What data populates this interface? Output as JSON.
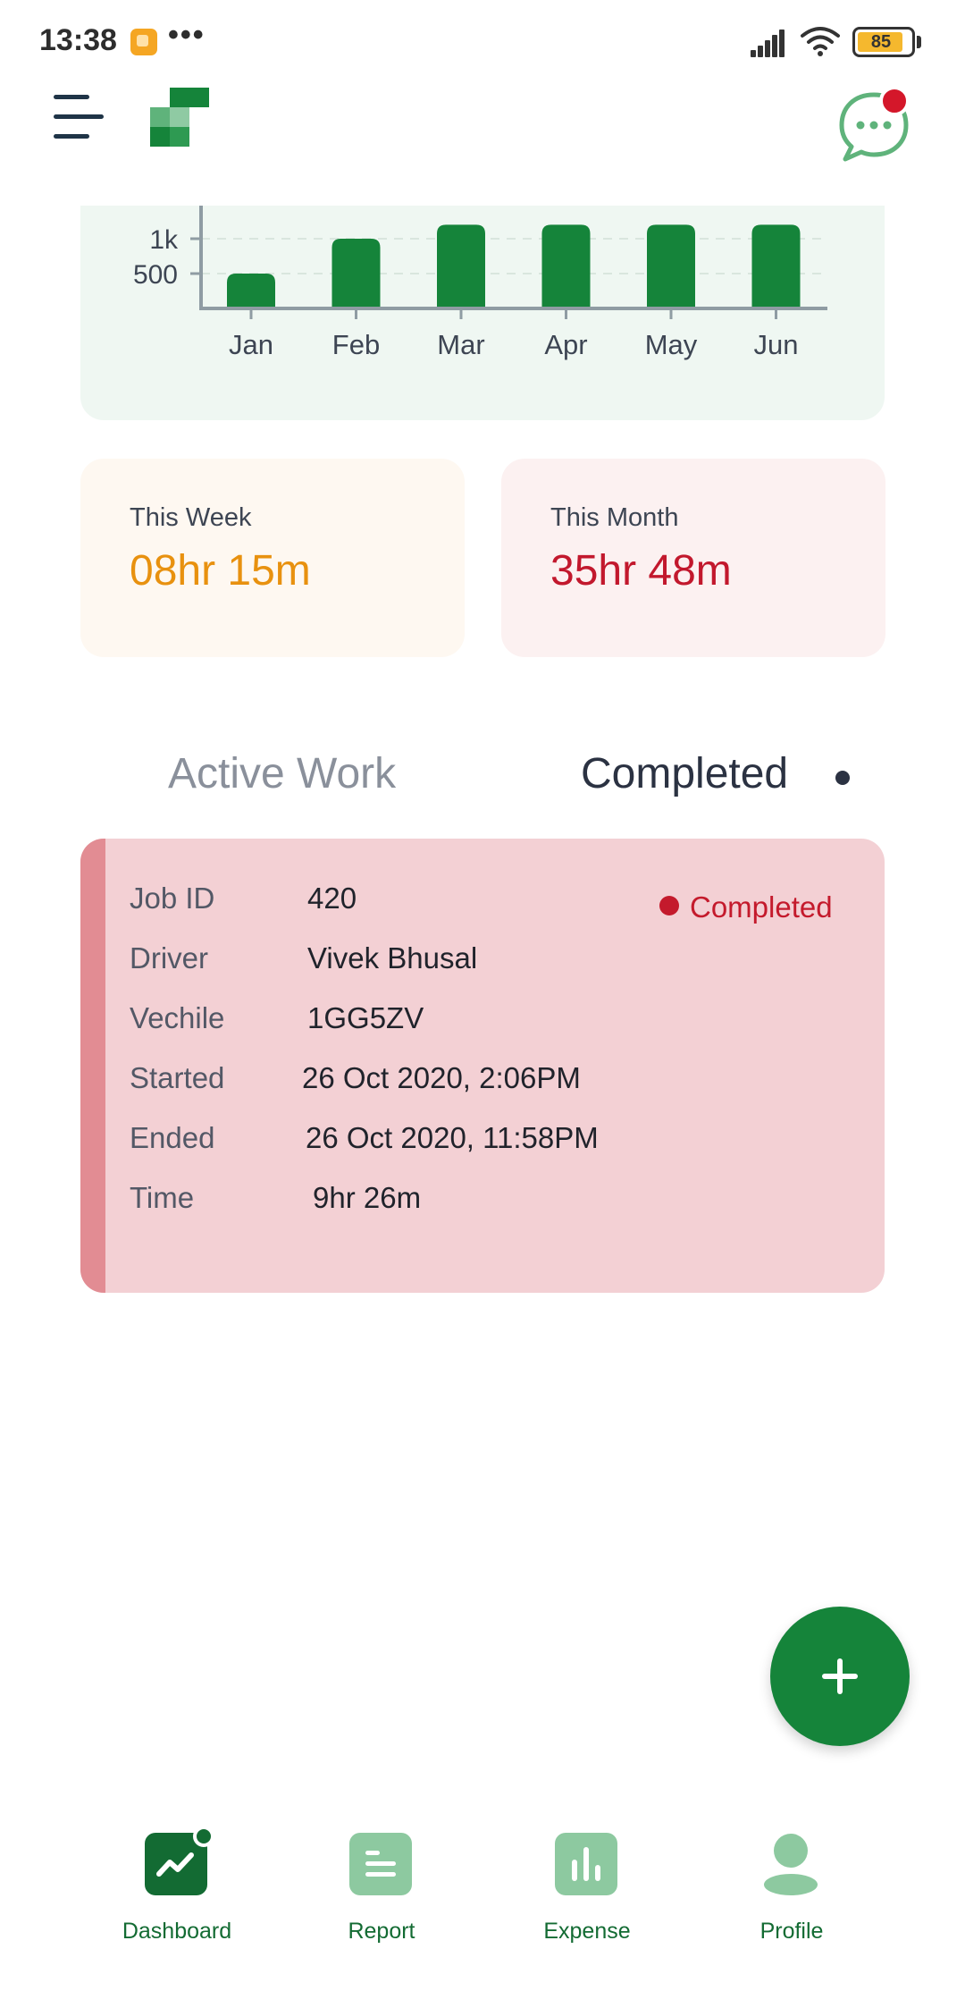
{
  "status_bar": {
    "time": "13:38",
    "dots": "•••",
    "battery_level": "85"
  },
  "header": {
    "menu_icon": "hamburger-menu-icon",
    "logo_icon": "app-logo",
    "chat_icon": "chat-bubble-icon",
    "chat_has_notification": true
  },
  "chart_data": {
    "type": "bar",
    "categories": [
      "Jan",
      "Feb",
      "Mar",
      "Apr",
      "May",
      "Jun"
    ],
    "values": [
      500,
      1000,
      1200,
      1200,
      1200,
      1200
    ],
    "y_ticks_visible": [
      "1k",
      "500"
    ],
    "ylim_visible": [
      0,
      1000
    ],
    "color": "#15843a",
    "title": "",
    "xlabel": "",
    "ylabel": ""
  },
  "stats": {
    "week": {
      "label": "This Week",
      "value": "08hr 15m"
    },
    "month": {
      "label": "This Month",
      "value": "35hr 48m"
    }
  },
  "tabs": {
    "active_work": "Active Work",
    "completed": "Completed",
    "selected": "Completed"
  },
  "job": {
    "status": "Completed",
    "rows": [
      {
        "key": "Job ID",
        "value": "420"
      },
      {
        "key": "Driver",
        "value": "Vivek Bhusal"
      },
      {
        "key": "Vechile",
        "value": "1GG5ZV"
      },
      {
        "key": "Started",
        "value": "26 Oct 2020, 2:06PM"
      },
      {
        "key": "Ended",
        "value": "26 Oct 2020, 11:58PM"
      },
      {
        "key": "Time",
        "value": "9hr 26m"
      }
    ]
  },
  "fab": {
    "icon": "plus-icon"
  },
  "nav": {
    "items": [
      {
        "label": "Dashboard",
        "icon": "dashboard-chart-icon",
        "active": true
      },
      {
        "label": "Report",
        "icon": "report-icon",
        "active": false
      },
      {
        "label": "Expense",
        "icon": "expense-bars-icon",
        "active": false
      },
      {
        "label": "Profile",
        "icon": "profile-person-icon",
        "active": false
      }
    ]
  },
  "colors": {
    "brand_green": "#15843a",
    "week_accent": "#e8910f",
    "month_accent": "#c2182d",
    "card_pink": "#f3d0d4"
  }
}
